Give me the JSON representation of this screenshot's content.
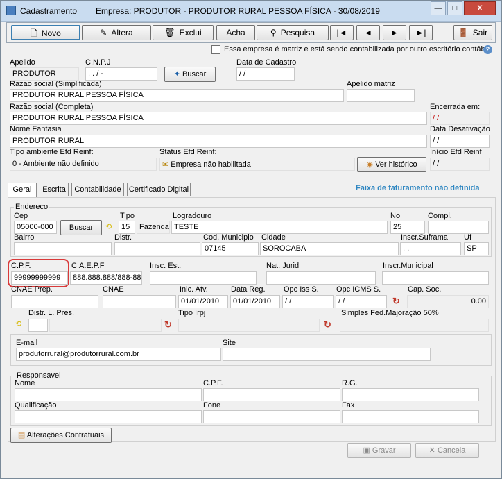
{
  "titlebar": {
    "app_title": "Cadastramento",
    "window_title": "Empresa: PRODUTOR - PRODUTOR RURAL PESSOA FÍSICA - 30/08/2019",
    "minimize": "—",
    "maximize": "□",
    "close": "X"
  },
  "toolbar": {
    "novo": "Novo",
    "altera": "Altera",
    "exclui": "Exclui",
    "acha": "Acha",
    "pesquisa": "Pesquisa",
    "first": "|◄",
    "prev": "◄",
    "next": "►",
    "last": "►|",
    "sair": "Sair"
  },
  "matriz_checkbox_label": "Essa empresa é matriz e está sendo contabilizada por outro escritório contábil",
  "header_fields": {
    "apelido_label": "Apelido",
    "apelido_value": "PRODUTOR",
    "cnpj_label": "C.N.P.J",
    "cnpj_value": "  .   .   /    -",
    "buscar_label": "Buscar",
    "data_cadastro_label": "Data de Cadastro",
    "data_cadastro_value": " / /",
    "razao_simpl_label": "Razao social (Simplificada)",
    "razao_simpl_value": "PRODUTOR RURAL PESSOA FÍSICA",
    "apelido_matriz_label": "Apelido matriz",
    "apelido_matriz_value": "",
    "razao_completa_label": "Razão social (Completa)",
    "razao_completa_value": "PRODUTOR RURAL PESSOA FÍSICA",
    "encerrada_label": "Encerrada em:",
    "encerrada_value": " / /",
    "nome_fantasia_label": "Nome Fantasia",
    "nome_fantasia_value": "PRODUTOR RURAL",
    "data_desativacao_label": "Data Desativação",
    "data_desativacao_value": " / /",
    "tipo_ambiente_label": "Tipo ambiente Efd Reinf:",
    "tipo_ambiente_value": "0 - Ambiente não definido",
    "status_efd_label": "Status Efd Reinf:",
    "status_efd_value": "Empresa não habilitada",
    "ver_historico_label": "Ver histórico",
    "inicio_efd_label": "Início Efd Reinf",
    "inicio_efd_value": " / /"
  },
  "tabs": [
    "Geral",
    "Escrita",
    "Contabilidade",
    "Certificado Digital"
  ],
  "faixa_faturamento": "Faixa de faturamento não definida",
  "endereco": {
    "group_label": "Endereco",
    "cep_label": "Cep",
    "cep_value": "05000-000",
    "buscar_label": "Buscar",
    "tipo_label": "Tipo",
    "tipo_code": "15",
    "tipo_value": "Fazenda",
    "logradouro_label": "Logradouro",
    "logradouro_value": "TESTE",
    "no_label": "No",
    "no_value": "25",
    "compl_label": "Compl.",
    "compl_value": "",
    "bairro_label": "Bairro",
    "bairro_value": "",
    "distr_label": "Distr.",
    "distr_value": "",
    "cod_municipio_label": "Cod. Municipio",
    "cod_municipio_value": "07145",
    "cidade_label": "Cidade",
    "cidade_value": "SOROCABA",
    "inscr_suframa_label": "Inscr.Suframa",
    "inscr_suframa_value": "   .   .   ",
    "uf_label": "Uf",
    "uf_value": "SP"
  },
  "fiscal": {
    "cpf_label": "C.P.F.",
    "cpf_value": "99999999999",
    "caepf_label": "C.A.E.P.F",
    "caepf_value": "888.888.888/888-88",
    "insc_est_label": "Insc. Est.",
    "insc_est_value": "",
    "nat_jurid_label": "Nat. Jurid",
    "nat_jurid_value": "",
    "inscr_municipal_label": "Inscr.Municipal",
    "inscr_municipal_value": "",
    "cnae_prep_label": "CNAE Prep.",
    "cnae_prep_value": "",
    "cnae_label": "CNAE",
    "cnae_value": "",
    "inic_atv_label": "Inic. Atv.",
    "inic_atv_value": "01/01/2010",
    "data_reg_label": "Data Reg.",
    "data_reg_value": "01/01/2010",
    "opc_iss_label": "Opc Iss S.",
    "opc_iss_value": " / /",
    "opc_icms_label": "Opc ICMS S.",
    "opc_icms_value": " / /",
    "cap_soc_label": "Cap. Soc.",
    "cap_soc_value": "0.00",
    "distr_l_pres_label": "Distr. L. Pres.",
    "tipo_irpj_label": "Tipo Irpj",
    "simples_label": "Simples Fed.Majoração 50%"
  },
  "contato": {
    "email_label": "E-mail",
    "email_value": "produtorrural@produtorrural.com.br",
    "site_label": "Site",
    "site_value": ""
  },
  "responsavel": {
    "group_label": "Responsavel",
    "nome_label": "Nome",
    "cpf_label": "C.P.F.",
    "rg_label": "R.G.",
    "qualificacao_label": "Qualificação",
    "fone_label": "Fone",
    "fax_label": "Fax"
  },
  "footer": {
    "alteracoes_label": "Alterações Contratuais",
    "gravar_label": "Gravar",
    "cancela_label": "Cancela"
  },
  "colors": {
    "highlight": "#d93a3a",
    "faixa_text": "#2e86c1",
    "red_date": "#c00000"
  }
}
